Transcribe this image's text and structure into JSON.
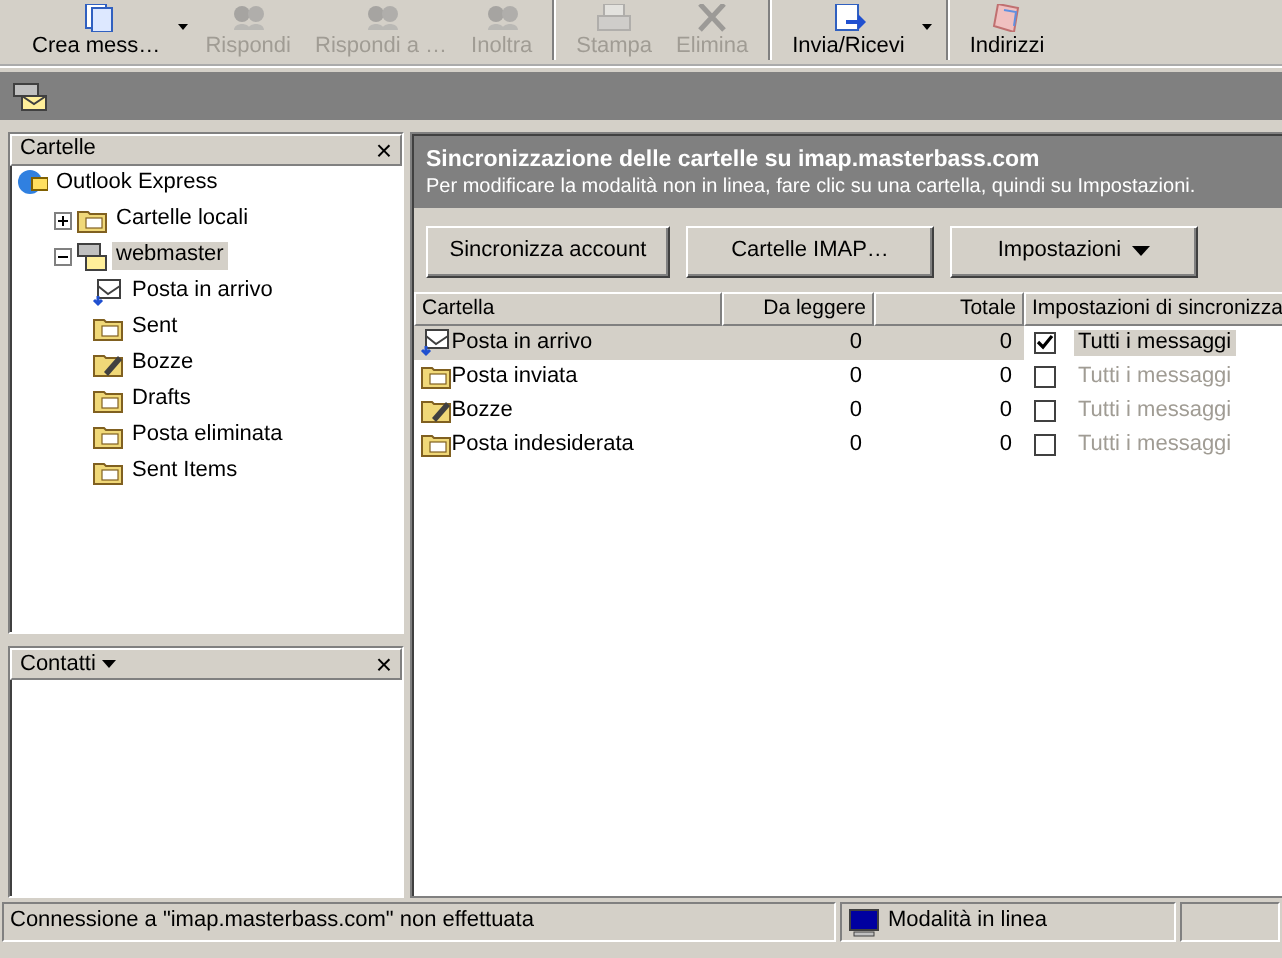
{
  "toolbar": [
    {
      "label": "Crea mess…",
      "disabled": false,
      "dropdown": true,
      "kind": "new"
    },
    {
      "label": "Rispondi",
      "disabled": true,
      "dropdown": false,
      "kind": "people"
    },
    {
      "label": "Rispondi a …",
      "disabled": true,
      "dropdown": false,
      "kind": "people"
    },
    {
      "label": "Inoltra",
      "disabled": true,
      "dropdown": false,
      "kind": "people"
    },
    {
      "label": "Stampa",
      "disabled": true,
      "dropdown": false,
      "kind": "printer"
    },
    {
      "label": "Elimina",
      "disabled": true,
      "dropdown": false,
      "kind": "cross"
    },
    {
      "label": "Invia/Ricevi",
      "disabled": false,
      "dropdown": true,
      "kind": "sendrecv"
    },
    {
      "label": "Indirizzi",
      "disabled": false,
      "dropdown": false,
      "kind": "book"
    }
  ],
  "folders_pane": {
    "title": "Cartelle",
    "close": "×",
    "tree": [
      {
        "label": "Outlook Express",
        "kind": "oe",
        "selected": false,
        "children": [
          {
            "label": "Cartelle locali",
            "kind": "folder",
            "selected": false,
            "expanded": false
          },
          {
            "label": "webmaster",
            "kind": "server",
            "selected": true,
            "expanded": true,
            "children": [
              {
                "label": "Posta in arrivo",
                "kind": "inbox",
                "selected": false
              },
              {
                "label": "Sent",
                "kind": "folder",
                "selected": false
              },
              {
                "label": "Bozze",
                "kind": "drafts",
                "selected": false
              },
              {
                "label": "Drafts",
                "kind": "folder",
                "selected": false
              },
              {
                "label": "Posta eliminata",
                "kind": "folder",
                "selected": false
              },
              {
                "label": "Sent Items",
                "kind": "folder",
                "selected": false
              }
            ]
          }
        ]
      }
    ]
  },
  "contacts_pane": {
    "title": "Contatti",
    "close": "×"
  },
  "sync_header": {
    "title": "Sincronizzazione delle cartelle su imap.masterbass.com",
    "subtitle": "Per modificare la modalità non in linea, fare clic su una cartella, quindi su Impostazioni."
  },
  "sync_buttons": [
    {
      "label": "Sincronizza account",
      "dropdown": false
    },
    {
      "label": "Cartelle IMAP…",
      "dropdown": false
    },
    {
      "label": "Impostazioni",
      "dropdown": true
    }
  ],
  "table": {
    "columns": [
      "Cartella",
      "Da leggere",
      "Totale",
      "Impostazioni di sincronizza"
    ],
    "rows": [
      {
        "folder": "Posta in arrivo",
        "kind": "inbox",
        "unread": "0",
        "total": "0",
        "checked": true,
        "setting": "Tutti i messaggi",
        "selected": true
      },
      {
        "folder": "Posta inviata",
        "kind": "folder",
        "unread": "0",
        "total": "0",
        "checked": false,
        "setting": "Tutti i messaggi",
        "selected": false
      },
      {
        "folder": "Bozze",
        "kind": "drafts",
        "unread": "0",
        "total": "0",
        "checked": false,
        "setting": "Tutti i messaggi",
        "selected": false
      },
      {
        "folder": "Posta indesiderata",
        "kind": "folder",
        "unread": "0",
        "total": "0",
        "checked": false,
        "setting": "Tutti i messaggi",
        "selected": false
      }
    ]
  },
  "status_bar": {
    "message": "Connessione a \"imap.masterbass.com\" non effettuata",
    "mode": "Modalità in linea"
  }
}
